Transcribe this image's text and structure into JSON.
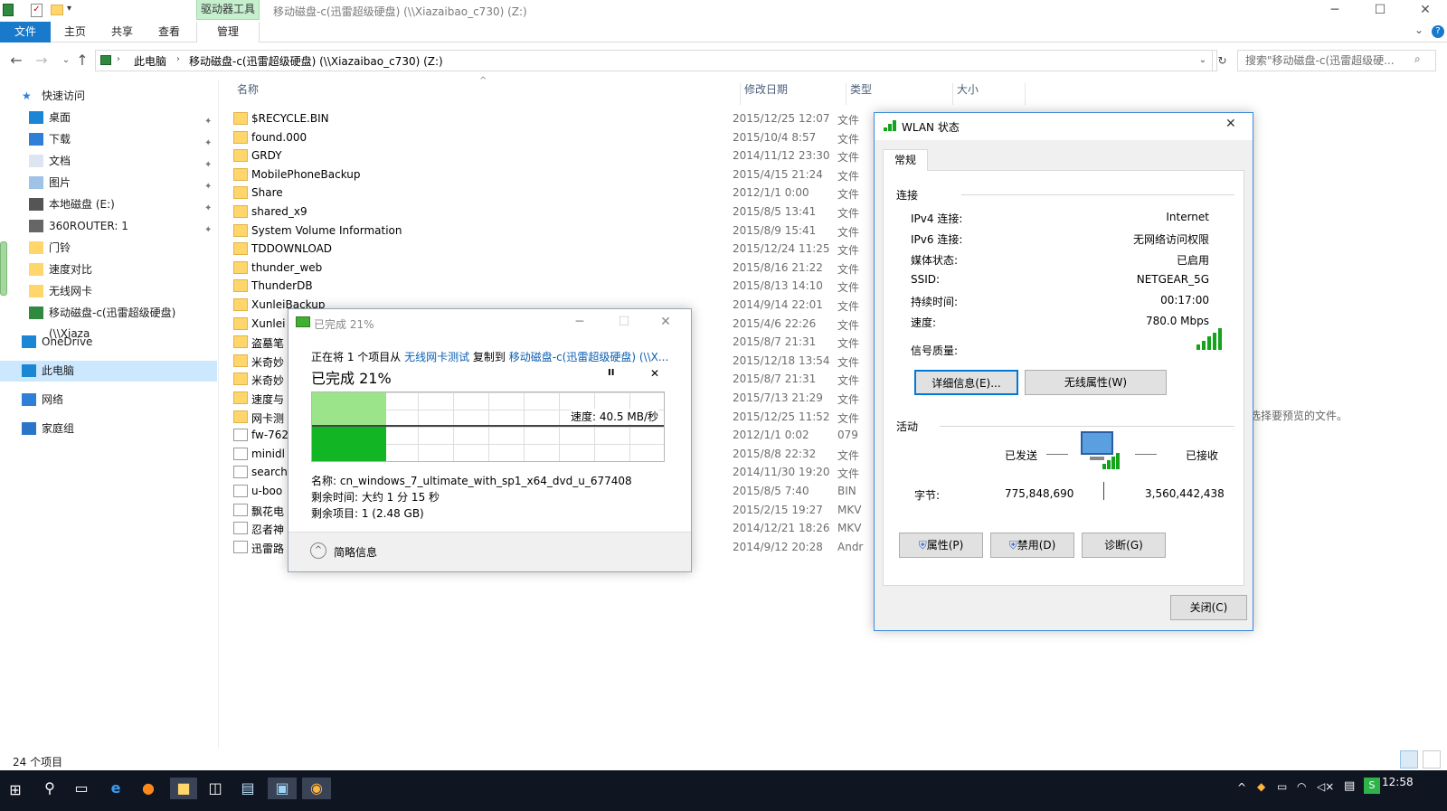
{
  "titlebar": {
    "drive_tools": "驱动器工具",
    "title": "移动磁盘-c(迅雷超级硬盘) (\\\\Xiazaibao_c730) (Z:)",
    "minimize": "─",
    "maximize": "☐",
    "close": "✕"
  },
  "ribbon": {
    "tabs": [
      "文件",
      "主页",
      "共享",
      "查看",
      "管理"
    ],
    "expand": "⌄"
  },
  "address": {
    "crumbs": [
      "此电脑",
      "移动磁盘-c(迅雷超级硬盘) (\\\\Xiazaibao_c730) (Z:)"
    ],
    "search_placeholder": "搜索\"移动磁盘-c(迅雷超级硬..."
  },
  "nav": {
    "items": [
      {
        "label": "快速访问",
        "icon": "star-icon"
      },
      {
        "label": "桌面",
        "icon": "desktop-icon",
        "pinned": true
      },
      {
        "label": "下载",
        "icon": "download-icon",
        "pinned": true
      },
      {
        "label": "文档",
        "icon": "document-icon",
        "pinned": true
      },
      {
        "label": "图片",
        "icon": "picture-icon",
        "pinned": true
      },
      {
        "label": "本地磁盘 (E:)",
        "icon": "drive-icon",
        "pinned": true
      },
      {
        "label": "360ROUTER: 1",
        "icon": "router-icon",
        "pinned": true
      },
      {
        "label": "门铃",
        "icon": "folder-icon"
      },
      {
        "label": "速度对比",
        "icon": "folder-icon"
      },
      {
        "label": "无线网卡",
        "icon": "folder-icon"
      },
      {
        "label": "移动磁盘-c(迅雷超级硬盘) (\\\\Xiaza",
        "icon": "network-drive-icon"
      },
      {
        "label": "OneDrive",
        "icon": "cloud-icon"
      },
      {
        "label": "此电脑",
        "icon": "computer-icon"
      },
      {
        "label": "网络",
        "icon": "network-icon"
      },
      {
        "label": "家庭组",
        "icon": "homegroup-icon"
      }
    ]
  },
  "columns": {
    "name": "名称",
    "date": "修改日期",
    "type": "类型",
    "size": "大小"
  },
  "files": [
    {
      "name": "$RECYCLE.BIN",
      "date": "2015/12/25 12:07",
      "type": "文件",
      "icon": "folder"
    },
    {
      "name": "found.000",
      "date": "2015/10/4 8:57",
      "type": "文件",
      "icon": "folder"
    },
    {
      "name": "GRDY",
      "date": "2014/11/12 23:30",
      "type": "文件",
      "icon": "folder"
    },
    {
      "name": "MobilePhoneBackup",
      "date": "2015/4/15 21:24",
      "type": "文件",
      "icon": "folder"
    },
    {
      "name": "Share",
      "date": "2012/1/1 0:00",
      "type": "文件",
      "icon": "folder"
    },
    {
      "name": "shared_x9",
      "date": "2015/8/5 13:41",
      "type": "文件",
      "icon": "folder"
    },
    {
      "name": "System Volume Information",
      "date": "2015/8/9 15:41",
      "type": "文件",
      "icon": "folder"
    },
    {
      "name": "TDDOWNLOAD",
      "date": "2015/12/24 11:25",
      "type": "文件",
      "icon": "folder"
    },
    {
      "name": "thunder_web",
      "date": "2015/8/16 21:22",
      "type": "文件",
      "icon": "folder"
    },
    {
      "name": "ThunderDB",
      "date": "2015/8/13 14:10",
      "type": "文件",
      "icon": "folder"
    },
    {
      "name": "XunleiBackup",
      "date": "2014/9/14 22:01",
      "type": "文件",
      "icon": "folder"
    },
    {
      "name": "Xunlei",
      "date": "2015/4/6 22:26",
      "type": "文件",
      "icon": "folder"
    },
    {
      "name": "盗墓笔",
      "date": "2015/8/7 21:31",
      "type": "文件",
      "icon": "folder"
    },
    {
      "name": "米奇妙",
      "date": "2015/12/18 13:54",
      "type": "文件",
      "icon": "folder"
    },
    {
      "name": "米奇妙",
      "date": "2015/8/7 21:31",
      "type": "文件",
      "icon": "folder"
    },
    {
      "name": "速度与",
      "date": "2015/7/13 21:29",
      "type": "文件",
      "icon": "folder"
    },
    {
      "name": "网卡测",
      "date": "2015/12/25 11:52",
      "type": "文件",
      "icon": "folder"
    },
    {
      "name": "fw-762",
      "date": "2012/1/1 0:02",
      "type": "079",
      "icon": "doc"
    },
    {
      "name": "minidl",
      "date": "2015/8/8 22:32",
      "type": "文件",
      "icon": "doc"
    },
    {
      "name": "search",
      "date": "2014/11/30 19:20",
      "type": "文件",
      "icon": "doc"
    },
    {
      "name": "u-boo",
      "date": "2015/8/5 7:40",
      "type": "BIN",
      "icon": "doc"
    },
    {
      "name": "飘花电",
      "date": "2015/2/15 19:27",
      "type": "MKV",
      "icon": "doc"
    },
    {
      "name": "忍者神",
      "date": "2014/12/21 18:26",
      "type": "MKV",
      "icon": "doc"
    },
    {
      "name": "迅雷路",
      "date": "2014/9/12 20:28",
      "type": "Andr",
      "icon": "doc"
    }
  ],
  "preview_text": "选择要预览的文件。",
  "status": {
    "count": "24 个项目"
  },
  "taskbar": {
    "clock": "12:58"
  },
  "copy_dialog": {
    "title": "已完成 21%",
    "desc_prefix": "正在将 1 个项目从 ",
    "desc_source": "无线网卡测试",
    "desc_mid": " 复制到 ",
    "desc_dest": "移动磁盘-c(迅雷超级硬盘) (\\\\X...",
    "progress_label": "已完成 21%",
    "progress": 0.21,
    "pause": "II",
    "cancel": "✕",
    "speed": "速度: 40.5 MB/秒",
    "name": "名称: cn_windows_7_ultimate_with_sp1_x64_dvd_u_677408",
    "time_left": "剩余时间: 大约 1 分 15 秒",
    "items_left": "剩余项目: 1 (2.48 GB)",
    "less_details": "简略信息"
  },
  "wlan": {
    "title": "WLAN 状态",
    "tab": "常规",
    "section_connection": "连接",
    "rows": [
      {
        "label": "IPv4 连接:",
        "value": "Internet"
      },
      {
        "label": "IPv6 连接:",
        "value": "无网络访问权限"
      },
      {
        "label": "媒体状态:",
        "value": "已启用"
      },
      {
        "label": "SSID:",
        "value": "NETGEAR_5G"
      },
      {
        "label": "持续时间:",
        "value": "00:17:00"
      },
      {
        "label": "速度:",
        "value": "780.0 Mbps"
      }
    ],
    "signal_label": "信号质量:",
    "signal_bars": 5,
    "details_btn": "详细信息(E)...",
    "wireless_props_btn": "无线属性(W)",
    "section_activity": "活动",
    "sent_label": "已发送",
    "received_label": "已接收",
    "bytes_label": "字节:",
    "bytes_sent": "775,848,690",
    "bytes_received": "3,560,442,438",
    "properties_btn": "属性(P)",
    "disable_btn": "禁用(D)",
    "diagnose_btn": "诊断(G)",
    "close_btn": "关闭(C)"
  }
}
